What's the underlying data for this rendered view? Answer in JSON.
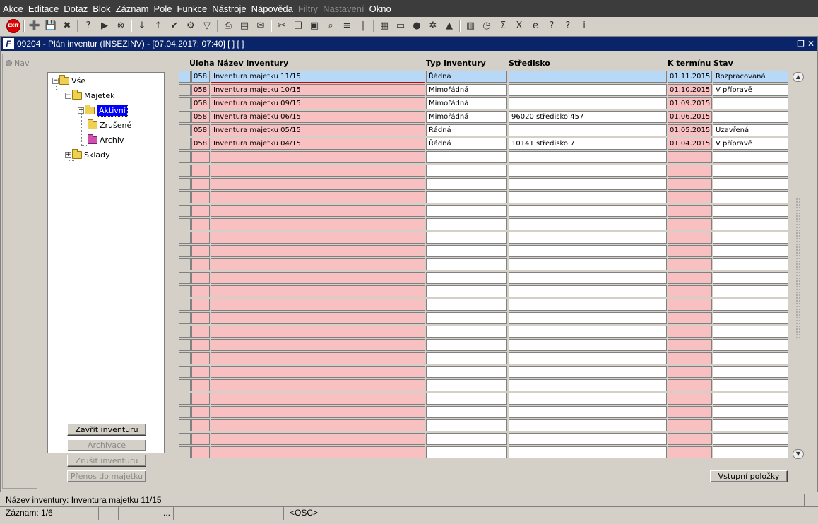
{
  "menu": [
    "Akce",
    "Editace",
    "Dotaz",
    "Blok",
    "Záznam",
    "Pole",
    "Funkce",
    "Nástroje",
    "Nápověda",
    "Filtry",
    "Nastavení",
    "Okno"
  ],
  "menu_disabled": [
    "Filtry",
    "Nastavení"
  ],
  "toolbar": {
    "exit_label": "EXIT",
    "icons": [
      "exit-icon",
      "sep",
      "insert-record-icon",
      "save-record-icon",
      "delete-record-icon",
      "sep",
      "query-icon",
      "execute-query-icon",
      "cancel-query-icon",
      "sep",
      "sort-asc-icon",
      "sort-desc-icon",
      "confirm-icon",
      "tools-icon",
      "filter-icon",
      "sep",
      "print-icon",
      "print-preview-icon",
      "mail-icon",
      "sep",
      "cut-icon",
      "copy-icon",
      "paste-icon",
      "zoom-icon",
      "list-icon",
      "columns-icon",
      "sep",
      "calculator-icon",
      "document-icon",
      "globe-icon",
      "settings-wheel-icon",
      "triangle-icon",
      "sep",
      "chart-icon",
      "clock-icon",
      "sum-icon",
      "excel-icon",
      "ie-icon",
      "help-icon",
      "about-icon",
      "info-icon"
    ]
  },
  "window": {
    "title": "09204 - Plán inventur (INSEZINV) - [07.04.2017; 07:40]  [ ]  [ ]",
    "app_icon": "F",
    "restore": "❐",
    "close": "✕"
  },
  "nav": {
    "label": "Nav"
  },
  "tree": {
    "root": "Vše",
    "majetek": "Majetek",
    "aktivni": "Aktivní",
    "zrusene": "Zrušené",
    "archiv": "Archiv",
    "sklady": "Sklady"
  },
  "buttons": {
    "zavrit": "Zavřít inventuru",
    "archivace": "Archivace",
    "zrusit": "Zrušit inventuru",
    "prenos": "Přenos do majetku",
    "vstupni": "Vstupní položky"
  },
  "grid": {
    "columns": {
      "uloha": "Úloha",
      "nazev": "Název inventury",
      "typ": "Typ inventury",
      "stredisko": "Středisko",
      "ktermin": "K termínu",
      "stav": "Stav"
    },
    "rows": [
      {
        "uloha": "058",
        "nazev": "Inventura majetku 11/15",
        "typ": "Řádná",
        "stredisko": "",
        "ktermin": "01.11.2015",
        "stav": "Rozpracovaná"
      },
      {
        "uloha": "058",
        "nazev": "Inventura majetku 10/15",
        "typ": "Mimořádná",
        "stredisko": "",
        "ktermin": "01.10.2015",
        "stav": "V přípravě"
      },
      {
        "uloha": "058",
        "nazev": "Inventura majetku 09/15",
        "typ": "Mimořádná",
        "stredisko": "",
        "ktermin": "01.09.2015",
        "stav": ""
      },
      {
        "uloha": "058",
        "nazev": "Inventura majetku 06/15",
        "typ": "Mimořádná",
        "stredisko": "96020 středisko 457",
        "ktermin": "01.06.2015",
        "stav": ""
      },
      {
        "uloha": "058",
        "nazev": "Inventura majetku 05/15",
        "typ": "Řádná",
        "stredisko": "",
        "ktermin": "01.05.2015",
        "stav": "Uzavřená"
      },
      {
        "uloha": "058",
        "nazev": "Inventura majetku 04/15",
        "typ": "Řádná",
        "stredisko": "10141 středisko 7",
        "ktermin": "01.04.2015",
        "stav": "V přípravě"
      }
    ],
    "total_rows": 29
  },
  "status": {
    "hint": "Název inventury: Inventura majetku 11/15",
    "record": "Záznam: 1/6",
    "ellipsis": "...",
    "osc": "<OSC>"
  }
}
